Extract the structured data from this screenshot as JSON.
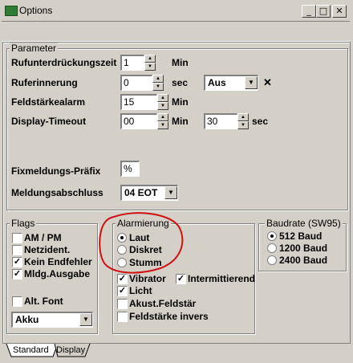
{
  "window": {
    "title": "Options",
    "minimize": "_",
    "maximize": "□",
    "close": "✕"
  },
  "parameter": {
    "legend": "Parameter",
    "rufunterdrueckungszeit": {
      "label": "Rufunterdrückungszeit",
      "value": "1",
      "unit": "Min"
    },
    "rufer_innerung": {
      "label": "Ruferinnerung",
      "value": "0",
      "unit": "sec",
      "select": "Aus",
      "clear": "✕"
    },
    "feldstaerkealarm": {
      "label": "Feldstärkealarm",
      "value": "15",
      "unit": "Min"
    },
    "display_timeout": {
      "label": "Display-Timeout",
      "value": "00",
      "unit": "Min",
      "value2": "30",
      "unit2": "sec"
    },
    "fixmeldungs_praefix": {
      "label": "Fixmeldungs-Präfix",
      "value": "%"
    },
    "meldungsabschluss": {
      "label": "Meldungsabschluss",
      "select": "04 EOT"
    }
  },
  "flags": {
    "legend": "Flags",
    "items": [
      {
        "label": "AM / PM",
        "checked": false
      },
      {
        "label": "Netzident.",
        "checked": false
      },
      {
        "label": "Kein Endfehler",
        "checked": true
      },
      {
        "label": "Mldg.Ausgabe",
        "checked": true
      }
    ],
    "alt_font": {
      "label": "Alt. Font",
      "checked": false
    },
    "font_select": "Akku"
  },
  "alarmierung": {
    "legend": "Alarmierung",
    "options": [
      {
        "label": "Laut",
        "selected": true
      },
      {
        "label": "Diskret",
        "selected": false
      },
      {
        "label": "Stumm",
        "selected": false
      }
    ],
    "checks": [
      {
        "label": "Vibrator",
        "checked": true
      },
      {
        "label": "Intermittierend",
        "checked": true
      },
      {
        "label": "Licht",
        "checked": true
      },
      {
        "label": "Akust.Feldstär",
        "checked": false
      },
      {
        "label": "Feldstärke invers",
        "checked": false
      }
    ]
  },
  "baudrate": {
    "legend": "Baudrate (SW95)",
    "options": [
      {
        "label": "512 Baud",
        "selected": true
      },
      {
        "label": "1200 Baud",
        "selected": false
      },
      {
        "label": "2400 Baud",
        "selected": false
      }
    ]
  },
  "tabs": [
    {
      "label": "Standard"
    },
    {
      "label": "Display"
    }
  ],
  "check_mark": "✓",
  "colors": {
    "annotation": "#d01010",
    "face": "#d4d0c8"
  }
}
